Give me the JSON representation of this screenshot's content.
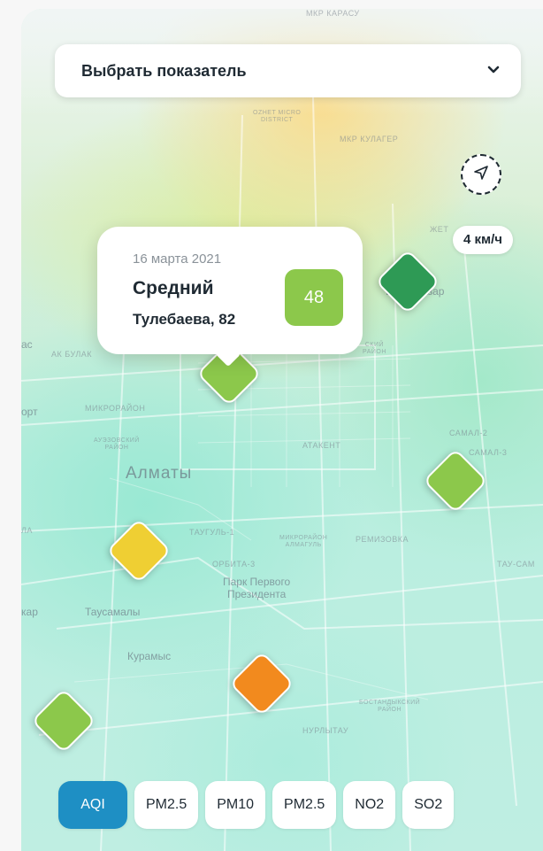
{
  "map": {
    "labels": {
      "karasu": "МКР КАРАСУ",
      "ozhet": "OZHET MICRO\nDISTRICT",
      "kulager": "МКР КУЛАГЕР",
      "zhet": "ЖЕТ",
      "bazar": "Бел... базар",
      "ac": "ас",
      "akbulak": "АК БУЛАК",
      "ort": "орт",
      "mikrorayon": "МИКРОРАЙОН",
      "auezov": "АУЭЗОВСКИЙ\nРАЙОН",
      "almaty": "Алматы",
      "atakent": "АТАКЕНТ",
      "samal2": "САМАЛ-2",
      "samal3": "САМАЛ-3",
      "skiy": "СКИЙ\nРАЙОН",
      "la": "ЛА",
      "taugul": "ТАУГУЛЬ-1",
      "mkr_almagul": "МИКРОРАЙОН\nАЛМАГУЛЬ",
      "remizovka": "РЕМИЗОВКА",
      "tay_sam": "ТАУ-САМ",
      "orbita": "ОРБИТА-3",
      "park": "Парк Первого\nПрезидента",
      "kar": "кар",
      "tausamaly": "Таусамалы",
      "kuramys": "Курамыс",
      "bostandyk": "БОСТАНДЫКСКИЙ\nРАЙОН",
      "nurlytau": "НУРЛЫТАУ"
    },
    "markers": [
      {
        "name": "marker-green-dark",
        "color": "#2e9a55"
      },
      {
        "name": "marker-selected",
        "color": "#8cc84b"
      },
      {
        "name": "marker-right",
        "color": "#8cc84b"
      },
      {
        "name": "marker-yellow",
        "color": "#efcf33"
      },
      {
        "name": "marker-orange",
        "color": "#f28a1e"
      },
      {
        "name": "marker-bottom-left",
        "color": "#8cc84b"
      }
    ]
  },
  "selector": {
    "label": "Выбрать показатель",
    "icon": "chevron-down-icon"
  },
  "locate_button": {
    "icon": "navigation-arrow-icon"
  },
  "speed": {
    "text": "4 км/ч"
  },
  "popup": {
    "date": "16 марта 2021",
    "status": "Средний",
    "address": "Тулебаева, 82",
    "value": "48",
    "badge_color": "#8cc84b"
  },
  "chips": [
    {
      "label": "AQI",
      "active": true
    },
    {
      "label": "PM2.5",
      "active": false
    },
    {
      "label": "PM10",
      "active": false
    },
    {
      "label": "PM2.5",
      "active": false
    },
    {
      "label": "NO2",
      "active": false
    },
    {
      "label": "SO2",
      "active": false
    }
  ],
  "colors": {
    "accent": "#1e8fc4",
    "text": "#1f2a33"
  }
}
